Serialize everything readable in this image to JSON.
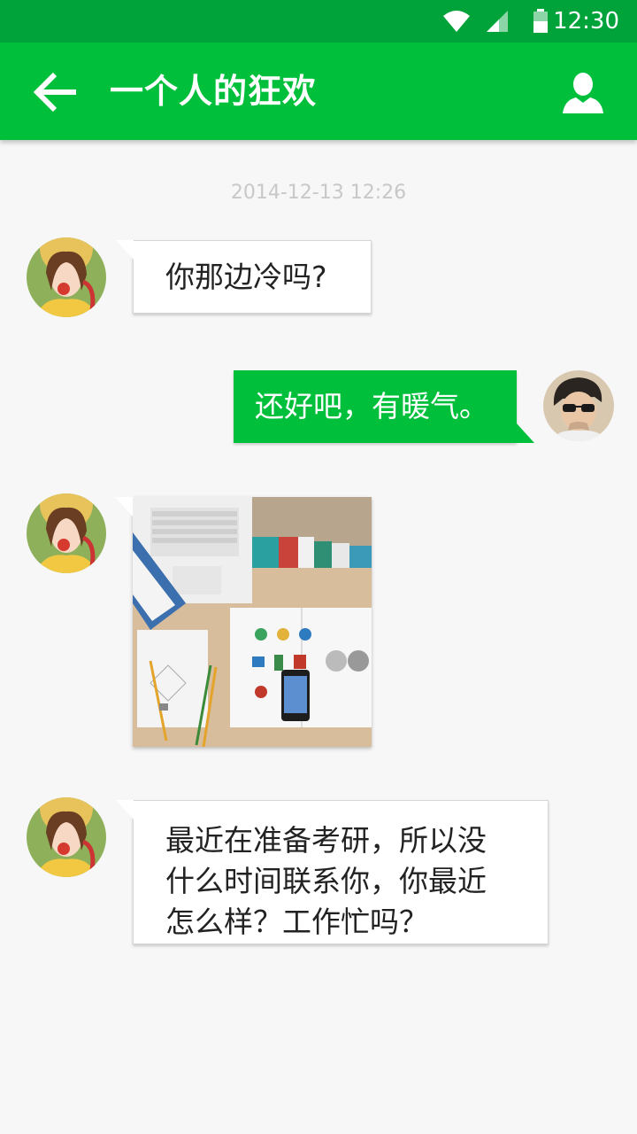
{
  "status_bar": {
    "time": "12:30",
    "icons": [
      "wifi-icon",
      "cell-signal-icon",
      "battery-icon"
    ]
  },
  "app_bar": {
    "title": "一个人的狂欢",
    "back_icon": "arrow-left-icon",
    "profile_icon": "person-icon",
    "color": "#00c03b",
    "status_color": "#00a33a"
  },
  "chat": {
    "timestamp": "2014-12-13  12:26",
    "messages": [
      {
        "sender": "contact",
        "type": "text",
        "text": "你那边冷吗?"
      },
      {
        "sender": "me",
        "type": "text",
        "text": "还好吧，有暖气。"
      },
      {
        "sender": "contact",
        "type": "image",
        "text": ""
      },
      {
        "sender": "contact",
        "type": "text",
        "lines": [
          "最近在准备考研，所以没",
          "什么时间联系你，你最近",
          "怎么样？工作忙吗？"
        ]
      }
    ]
  }
}
